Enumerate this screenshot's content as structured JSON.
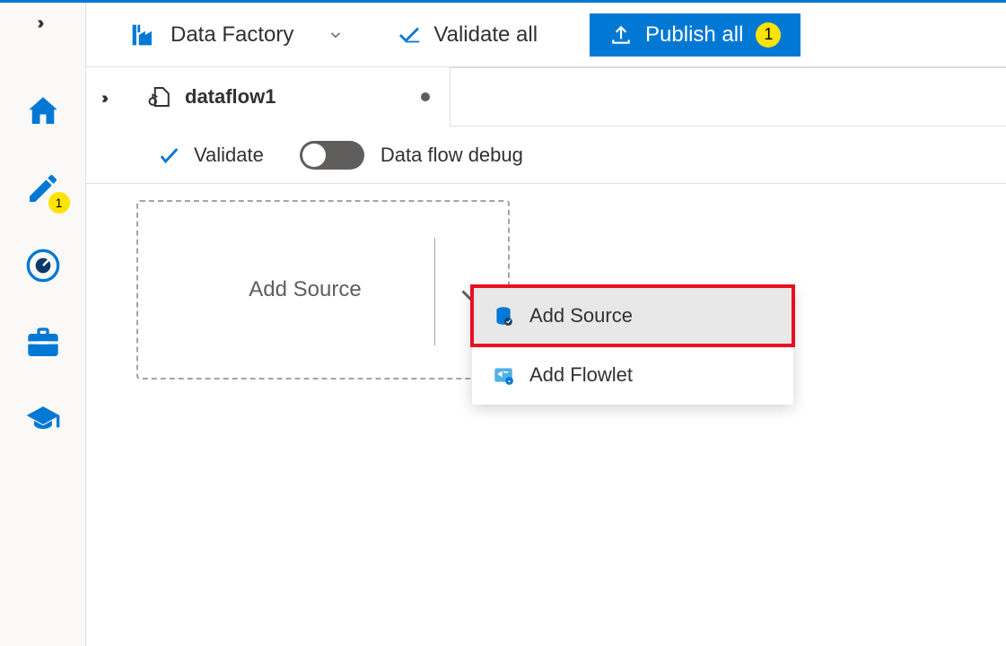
{
  "leftRail": {
    "pencilBadge": "1"
  },
  "topBar": {
    "brandLabel": "Data Factory",
    "validateAllLabel": "Validate all",
    "publishAllLabel": "Publish all",
    "publishBadge": "1"
  },
  "tab": {
    "title": "dataflow1"
  },
  "subToolbar": {
    "validateLabel": "Validate",
    "debugLabel": "Data flow debug"
  },
  "canvas": {
    "addSourcePlaceholder": "Add Source"
  },
  "popup": {
    "items": [
      {
        "label": "Add Source"
      },
      {
        "label": "Add Flowlet"
      }
    ]
  }
}
